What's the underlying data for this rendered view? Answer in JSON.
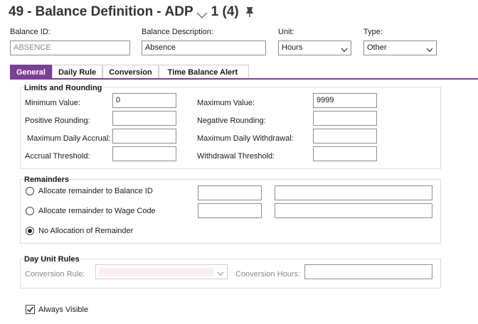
{
  "header": {
    "number": "49",
    "separator": "-",
    "title": "Balance Definition",
    "dash2": "-",
    "entity": "ADP",
    "record_count": "1 (4)"
  },
  "fields": {
    "balance_id": {
      "label": "Balance ID:",
      "value": "ABSENCE"
    },
    "balance_description": {
      "label": "Balance Description:",
      "value": "Absence"
    },
    "unit": {
      "label": "Unit:",
      "value": "Hours"
    },
    "type": {
      "label": "Type:",
      "value": "Other"
    }
  },
  "tabs": [
    {
      "label": "General",
      "active": true
    },
    {
      "label": "Daily Rule",
      "active": false
    },
    {
      "label": "Conversion",
      "active": false
    },
    {
      "label": "Time Balance Alert",
      "active": false
    }
  ],
  "limits": {
    "title": "Limits and Rounding",
    "minimum_value": {
      "label": "Minimum Value:",
      "value": "0"
    },
    "maximum_value": {
      "label": "Maximum Value:",
      "value": "9999"
    },
    "positive_rounding": {
      "label": "Positive Rounding:",
      "value": ""
    },
    "negative_rounding": {
      "label": "Negative Rounding:",
      "value": ""
    },
    "maximum_daily_accrual": {
      "label": "Maximum Daily Accrual:",
      "value": ""
    },
    "maximum_daily_withdrawal": {
      "label": "Maximum Daily Withdrawal:",
      "value": ""
    },
    "accrual_threshold": {
      "label": "Accrual Threshold:",
      "value": ""
    },
    "withdrawal_threshold": {
      "label": "Withdrawal Threshold:",
      "value": ""
    }
  },
  "remainders": {
    "title": "Remainders",
    "options": [
      {
        "label": "Allocate remainder to Balance ID",
        "selected": false
      },
      {
        "label": "Allocate remainder to Wage Code",
        "selected": false
      },
      {
        "label": "No Allocation of Remainder",
        "selected": true
      }
    ]
  },
  "day_unit_rules": {
    "title": "Day Unit Rules",
    "conversion_rule": {
      "label": "Conversion Rule:",
      "value": ""
    },
    "conversion_hours": {
      "label": "Conversion Hours:",
      "value": ""
    }
  },
  "always_visible": {
    "label": "Always Visible",
    "checked": true
  },
  "colors": {
    "accent": "#7b3f98",
    "border": "#8f8f8f",
    "group_border": "#dcdcdc"
  },
  "icons": {
    "title_dropdown": "chevron-down-icon",
    "pin": "pin-icon",
    "select": "chevron-down-icon"
  }
}
